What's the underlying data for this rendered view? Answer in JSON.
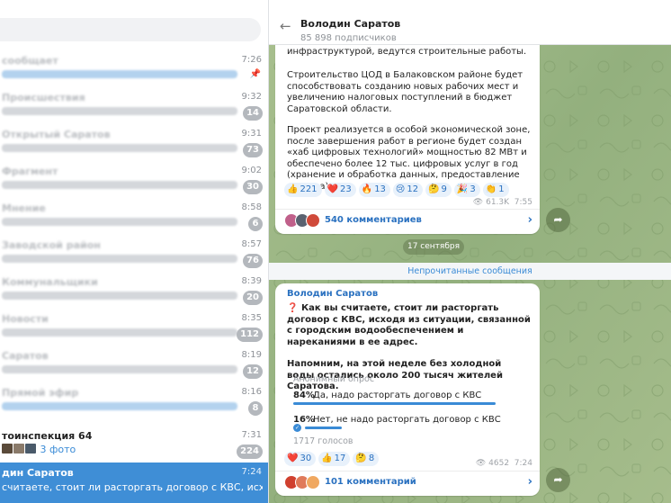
{
  "chat_list": {
    "items": [
      {
        "name": "сообщает",
        "time": "7:26",
        "preview_type": "link",
        "pinned": true
      },
      {
        "name": "Происшествия",
        "time": "9:32",
        "badge": "14"
      },
      {
        "name": "Открытый Саратов",
        "time": "9:31",
        "badge": "73"
      },
      {
        "name": "Фрагмент",
        "time": "9:02",
        "badge": "30"
      },
      {
        "name": "Мнение",
        "time": "8:58",
        "badge": "6"
      },
      {
        "name": "Заводской район",
        "time": "8:57",
        "badge": "76"
      },
      {
        "name": "Коммунальщики",
        "time": "8:39",
        "badge": "20"
      },
      {
        "name": "Новости",
        "time": "8:35",
        "badge": "112"
      },
      {
        "name": "Саратов",
        "time": "8:19",
        "badge": "12"
      },
      {
        "name": "Прямой эфир",
        "time": "8:16",
        "badge": "8",
        "preview_type": "link"
      },
      {
        "name": "тоинспекция 64",
        "time": "7:31",
        "badge": "224",
        "preview_text": "3 фото"
      },
      {
        "name": "дин Саратов",
        "time": "7:24",
        "active": true,
        "preview_text": "считаете, стоит ли расторгать договор с КВС, исходя из ситуации, свя..."
      }
    ]
  },
  "channel": {
    "title": "Володин Саратов",
    "subscribers": "85 898 подписчиков"
  },
  "post1": {
    "text_top": "инфраструктурой, ведутся строительные работы.",
    "text_p2": "Строительство ЦОД в Балаковском районе будет способствовать созданию новых рабочих мест и увеличению налоговых поступлений в бюджет Саратовской области.",
    "text_p3": "Проект реализуется в особой экономической зоне, после завершения работ в регионе будет создан «хаб цифровых технологий» мощностью 82 МВт и обеспечено более 12 тыс. цифровых услуг в год (хранение и обработка данных, предоставление сервера).",
    "reactions": [
      {
        "emoji": "👍",
        "count": "221"
      },
      {
        "emoji": "❤️",
        "count": "23"
      },
      {
        "emoji": "🔥",
        "count": "13"
      },
      {
        "emoji": "😢",
        "count": "12"
      },
      {
        "emoji": "🤔",
        "count": "9"
      },
      {
        "emoji": "🎉",
        "count": "3"
      },
      {
        "emoji": "👏",
        "count": "1"
      }
    ],
    "views": "61.3K",
    "time": "7:55",
    "comments": "540 комментариев"
  },
  "date_divider": "17 сентября",
  "unread_label": "Непрочитанные сообщения",
  "post2": {
    "author": "Володин Саратов",
    "question_mark": "❓",
    "question": "Как вы считаете, стоит ли расторгать договор с КВС, исходя из ситуации, связанной с городским водообеспечением и нареканиями в ее адрес.",
    "note": "Напомним, на этой неделе без холодной воды остались около 200 тысяч жителей Саратова.",
    "poll_kind": "Анонимный опрос",
    "options": [
      {
        "percent": "84%",
        "label": "Да, надо расторгать договор с КВС",
        "fraction": 0.84,
        "voted": false
      },
      {
        "percent": "16%",
        "label": "Нет, не надо расторгать договор с КВС",
        "fraction": 0.16,
        "voted": true
      }
    ],
    "votes": "1717 голосов",
    "reactions": [
      {
        "emoji": "❤️",
        "count": "30"
      },
      {
        "emoji": "👍",
        "count": "17"
      },
      {
        "emoji": "🤔",
        "count": "8"
      }
    ],
    "views": "4652",
    "time": "7:24",
    "comments": "101 комментарий"
  },
  "colors": {
    "accent": "#3a8bd6",
    "active_row": "#3f8ed6",
    "wallpaper": "#9fb88b"
  }
}
